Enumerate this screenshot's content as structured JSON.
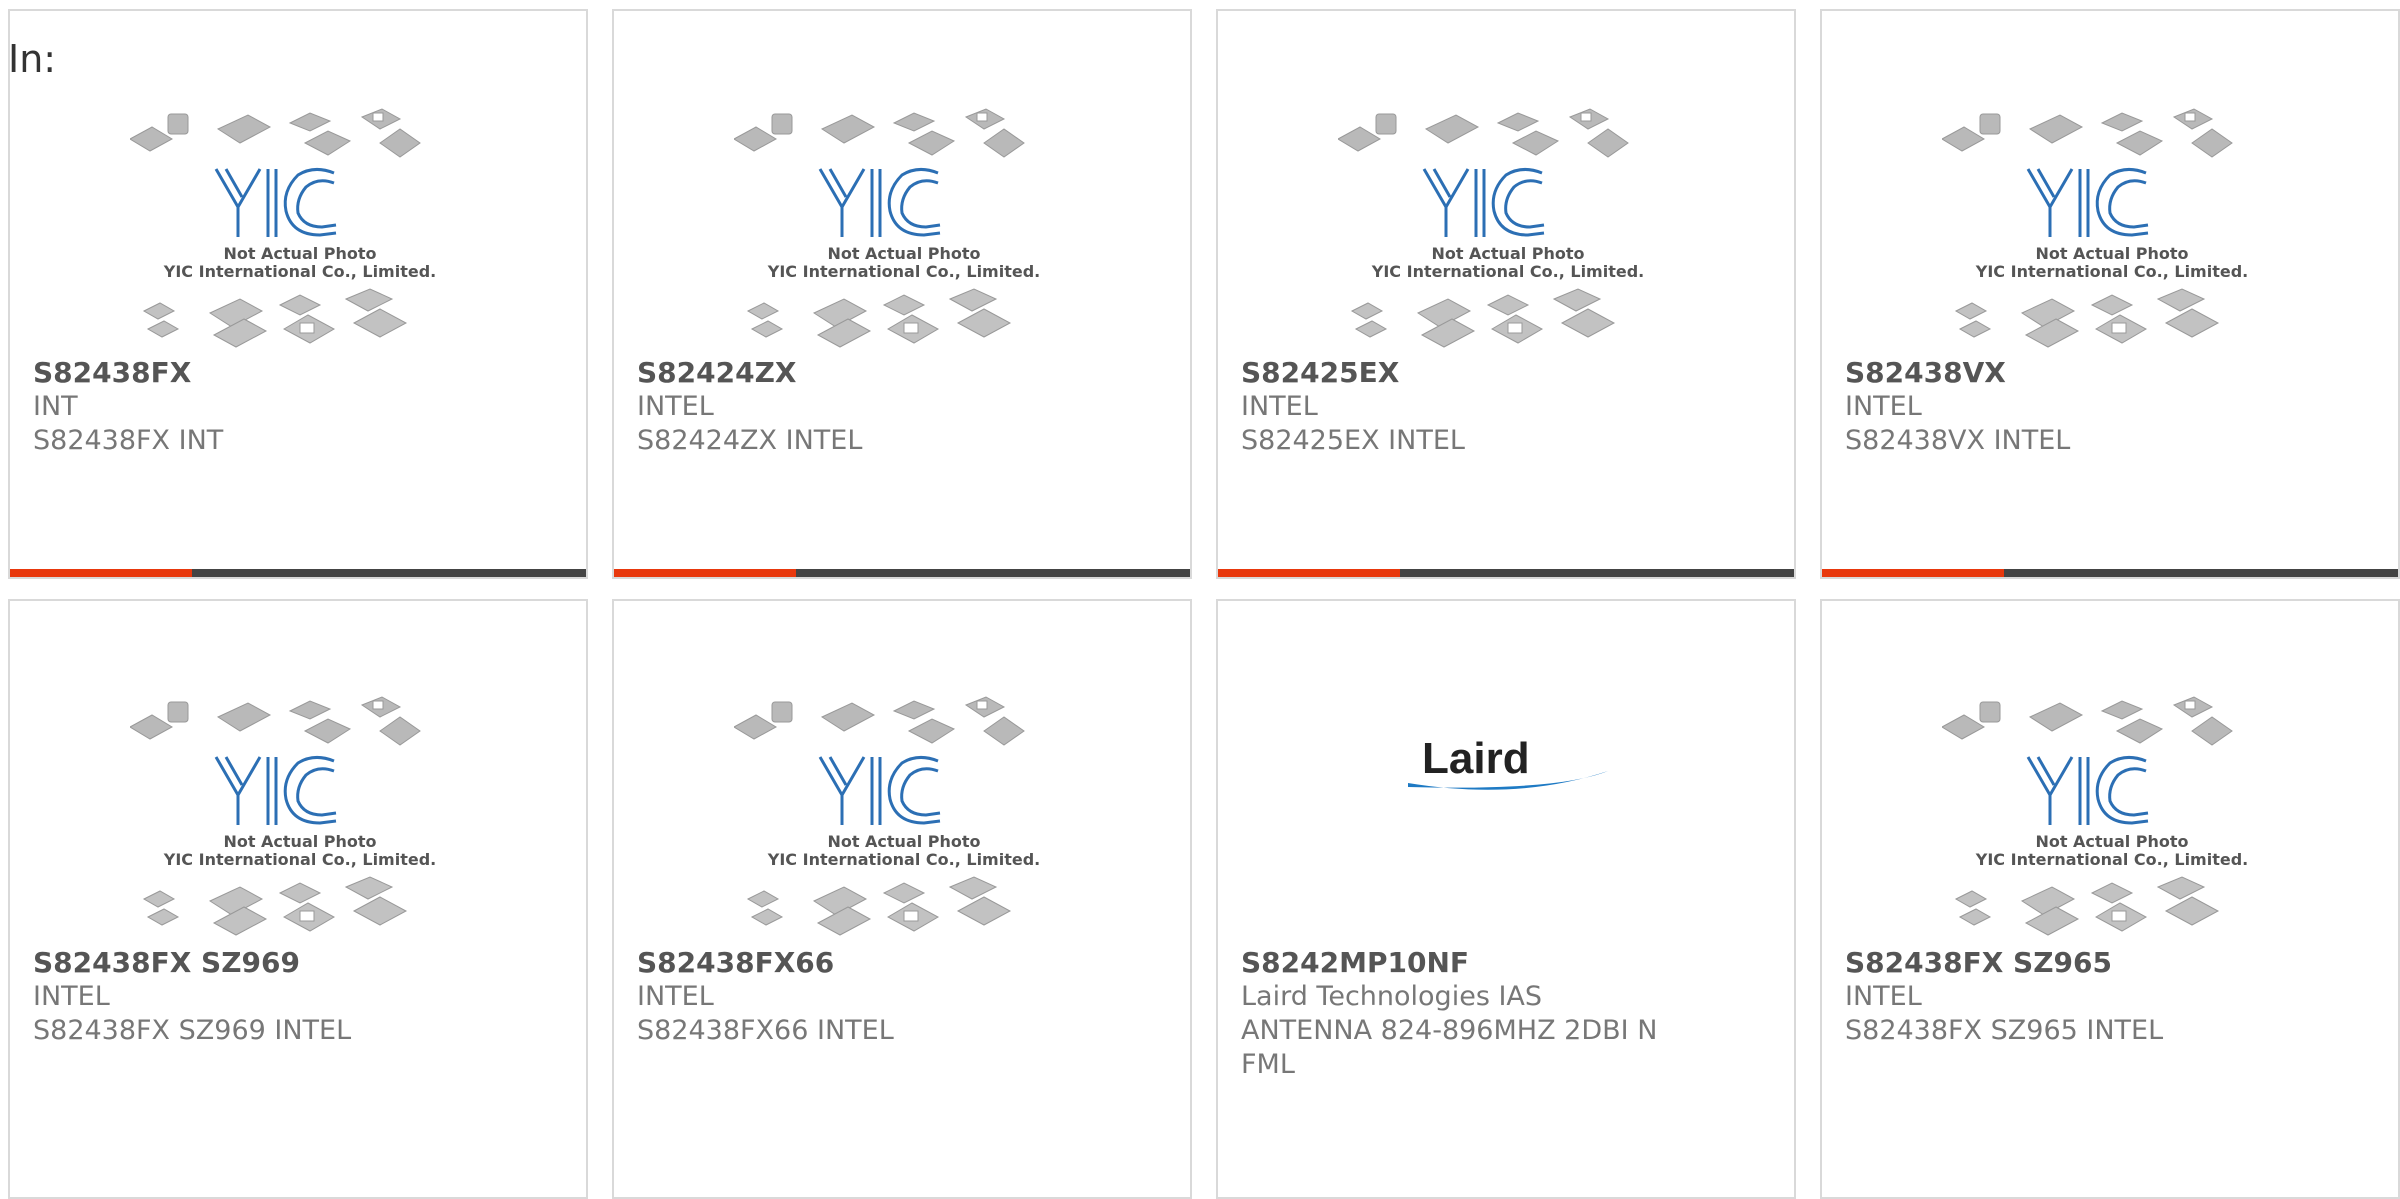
{
  "page": {
    "label": "In:"
  },
  "colors": {
    "accent": "#e8380d",
    "bar": "#444444",
    "yic_blue": "#2c6fb4"
  },
  "placeholder": {
    "caption_line1": "Not Actual Photo",
    "caption_line2": "YIC International Co., Limited.",
    "logo_text": "YIC"
  },
  "products": [
    {
      "part": "S82438FX",
      "mfr": "INT",
      "desc": "S82438FX INT",
      "image": "yic-placeholder"
    },
    {
      "part": "S82424ZX",
      "mfr": "INTEL",
      "desc": "S82424ZX INTEL",
      "image": "yic-placeholder"
    },
    {
      "part": "S82425EX",
      "mfr": "INTEL",
      "desc": "S82425EX INTEL",
      "image": "yic-placeholder"
    },
    {
      "part": "S82438VX",
      "mfr": "INTEL",
      "desc": "S82438VX INTEL",
      "image": "yic-placeholder"
    },
    {
      "part": "S82438FX SZ969",
      "mfr": "INTEL",
      "desc": "S82438FX SZ969 INTEL",
      "image": "yic-placeholder"
    },
    {
      "part": "S82438FX66",
      "mfr": "INTEL",
      "desc": "S82438FX66 INTEL",
      "image": "yic-placeholder"
    },
    {
      "part": "S8242MP10NF",
      "mfr": "Laird Technologies IAS",
      "desc": "ANTENNA 824-896MHZ 2DBI N FML",
      "image": "laird-logo",
      "logo_text": "Laird"
    },
    {
      "part": "S82438FX SZ965",
      "mfr": "INTEL",
      "desc": "S82438FX SZ965 INTEL",
      "image": "yic-placeholder"
    }
  ]
}
